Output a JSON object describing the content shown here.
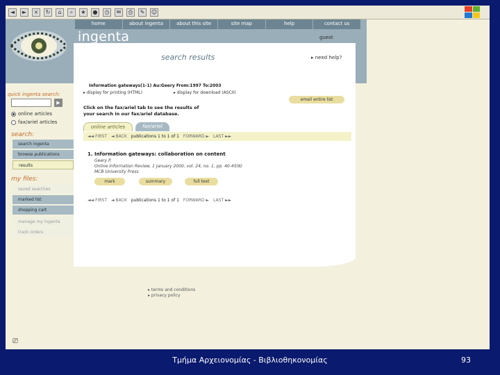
{
  "nav": {
    "items": [
      "home",
      "about ingenta",
      "about this site",
      "site map",
      "help",
      "contact us"
    ]
  },
  "brand": "ingenta",
  "guest": "guest",
  "search_results_title": "search results",
  "help_link": "need help?",
  "quick_search": {
    "label": "quick ingenta search:",
    "go": "▶",
    "radios": [
      "online articles",
      "fax/ariel articles"
    ]
  },
  "sidebar": {
    "search_heading": "search:",
    "search_items": [
      "search ingenta",
      "browse publications",
      "results"
    ],
    "files_heading": "my files:",
    "files_items": [
      "saved searches",
      "marked list",
      "shopping cart",
      "manage my ingenta",
      "track orders"
    ]
  },
  "main": {
    "info_line": "Information gateways(1-1) Au:Geery From:1997 To:2003",
    "options": [
      "display for printing (HTML)",
      "display for download (ASCII)"
    ],
    "email_button": "email entire list",
    "click_text_1": "Click on the fax/ariel tab to see the results of",
    "click_text_2": "your search in our fax/ariel database.",
    "tabs": [
      "online articles",
      "fax/ariel"
    ],
    "pager_first": "◄◄ FIRST",
    "pager_back": "◄ BACK",
    "pager_pubs": "publications 1 to 1 of 1",
    "pager_forward": "FORWARD ►",
    "pager_last": "LAST ►►",
    "result_title": "1. Information gateways: collaboration on content",
    "result_author": "Geery P.",
    "result_source": "Online Information Review, 1 January 2000, vol. 24, no. 1, pp. 40-45(6)",
    "result_publisher": "MCB University Press",
    "actions": [
      "mark",
      "summary",
      "full text"
    ]
  },
  "footer": {
    "links": [
      "▸ terms and conditions",
      "▸ privacy policy"
    ]
  },
  "slide": {
    "caption": "Τμήμα Αρχειονομίας - Βιβλιοθηκονομίας",
    "page_number": "93"
  },
  "colors": {
    "slide_bg": "#0a1a6e",
    "header_blue": "#9aaeb9",
    "accent_yellow": "#f4f2c8",
    "heading_orange": "#c06a2a"
  }
}
